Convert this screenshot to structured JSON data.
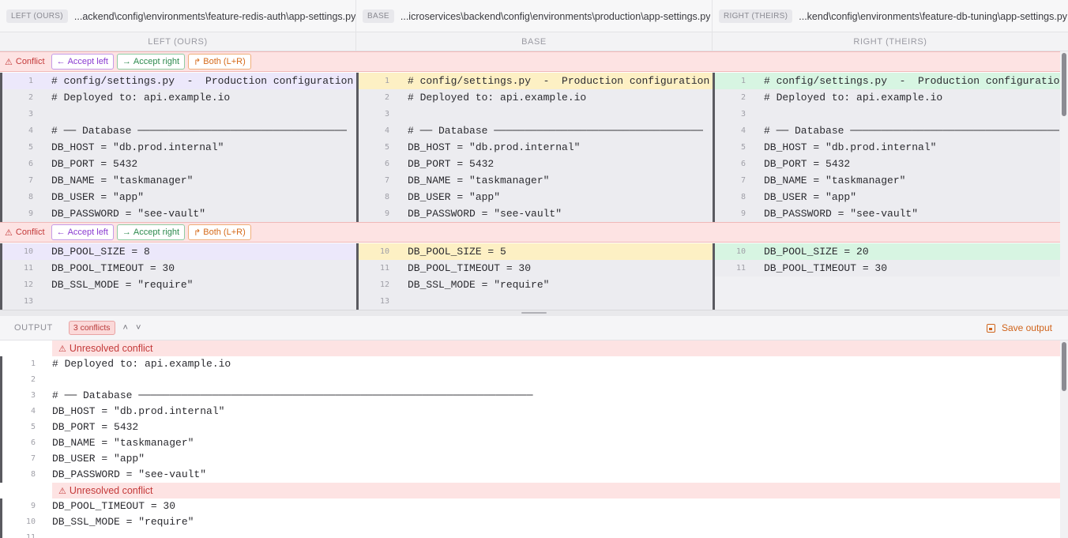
{
  "paths": [
    {
      "tag": "LEFT (OURS)",
      "path": "...ackend\\config\\environments\\feature-redis-auth\\app-settings.py"
    },
    {
      "tag": "BASE",
      "path": "...icroservices\\backend\\config\\environments\\production\\app-settings.py"
    },
    {
      "tag": "RIGHT (THEIRS)",
      "path": "...kend\\config\\environments\\feature-db-tuning\\app-settings.py"
    }
  ],
  "column_headers": [
    "LEFT (OURS)",
    "BASE",
    "RIGHT (THEIRS)"
  ],
  "conflict_bar": {
    "label": "Conflict",
    "accept_left": "Accept left",
    "accept_right": "Accept right",
    "both": "Both (L+R)"
  },
  "left_block1": [
    {
      "n": "1",
      "code": "# config/settings.py  -  Production configuration"
    },
    {
      "n": "2",
      "code": "# Deployed to: api.example.io"
    },
    {
      "n": "3",
      "code": ""
    },
    {
      "n": "4",
      "code": "# ── Database ──────────────────────────────────"
    },
    {
      "n": "5",
      "code": "DB_HOST = \"db.prod.internal\""
    },
    {
      "n": "6",
      "code": "DB_PORT = 5432"
    },
    {
      "n": "7",
      "code": "DB_NAME = \"taskmanager\""
    },
    {
      "n": "8",
      "code": "DB_USER = \"app\""
    },
    {
      "n": "9",
      "code": "DB_PASSWORD = \"see-vault\""
    }
  ],
  "left_block2": [
    {
      "n": "10",
      "code": "DB_POOL_SIZE = 8"
    },
    {
      "n": "11",
      "code": "DB_POOL_TIMEOUT = 30"
    },
    {
      "n": "12",
      "code": "DB_SSL_MODE = \"require\""
    },
    {
      "n": "13",
      "code": ""
    }
  ],
  "base_block1": [
    {
      "n": "1",
      "code": "# config/settings.py  -  Production configuration"
    },
    {
      "n": "2",
      "code": "# Deployed to: api.example.io"
    },
    {
      "n": "3",
      "code": ""
    },
    {
      "n": "4",
      "code": "# ── Database ──────────────────────────────────"
    },
    {
      "n": "5",
      "code": "DB_HOST = \"db.prod.internal\""
    },
    {
      "n": "6",
      "code": "DB_PORT = 5432"
    },
    {
      "n": "7",
      "code": "DB_NAME = \"taskmanager\""
    },
    {
      "n": "8",
      "code": "DB_USER = \"app\""
    },
    {
      "n": "9",
      "code": "DB_PASSWORD = \"see-vault\""
    }
  ],
  "base_block2": [
    {
      "n": "10",
      "code": "DB_POOL_SIZE = 5"
    },
    {
      "n": "11",
      "code": "DB_POOL_TIMEOUT = 30"
    },
    {
      "n": "12",
      "code": "DB_SSL_MODE = \"require\""
    },
    {
      "n": "13",
      "code": ""
    }
  ],
  "right_block1": [
    {
      "n": "1",
      "code": "# config/settings.py  -  Production configuratio"
    },
    {
      "n": "2",
      "code": "# Deployed to: api.example.io"
    },
    {
      "n": "3",
      "code": ""
    },
    {
      "n": "4",
      "code": "# ── Database ──────────────────────────────────"
    },
    {
      "n": "5",
      "code": "DB_HOST = \"db.prod.internal\""
    },
    {
      "n": "6",
      "code": "DB_PORT = 5432"
    },
    {
      "n": "7",
      "code": "DB_NAME = \"taskmanager\""
    },
    {
      "n": "8",
      "code": "DB_USER = \"app\""
    },
    {
      "n": "9",
      "code": "DB_PASSWORD = \"see-vault\""
    }
  ],
  "right_block2": [
    {
      "n": "10",
      "code": "DB_POOL_SIZE = 20"
    },
    {
      "n": "11",
      "code": "DB_POOL_TIMEOUT = 30"
    }
  ],
  "output": {
    "label": "OUTPUT",
    "badge": "3 conflicts",
    "prev_icon": "˄",
    "next_icon": "˅",
    "save_label": "Save output",
    "unresolved_label": "Unresolved conflict",
    "block1": [
      {
        "n": "1",
        "code": "# Deployed to: api.example.io"
      },
      {
        "n": "2",
        "code": ""
      },
      {
        "n": "3",
        "code": "# ── Database ────────────────────────────────────────────────────────────────"
      },
      {
        "n": "4",
        "code": "DB_HOST = \"db.prod.internal\""
      },
      {
        "n": "5",
        "code": "DB_PORT = 5432"
      },
      {
        "n": "6",
        "code": "DB_NAME = \"taskmanager\""
      },
      {
        "n": "7",
        "code": "DB_USER = \"app\""
      },
      {
        "n": "8",
        "code": "DB_PASSWORD = \"see-vault\""
      }
    ],
    "block2": [
      {
        "n": "9",
        "code": "DB_POOL_TIMEOUT = 30"
      },
      {
        "n": "10",
        "code": "DB_SSL_MODE = \"require\""
      },
      {
        "n": "11",
        "code": ""
      }
    ]
  },
  "colors": {
    "conflict_bg": "#fde3e3",
    "left_highlight": "#ece8fb",
    "base_highlight": "#fdf0c4",
    "right_highlight": "#d7f5e2",
    "accent_save": "#d0641c"
  }
}
